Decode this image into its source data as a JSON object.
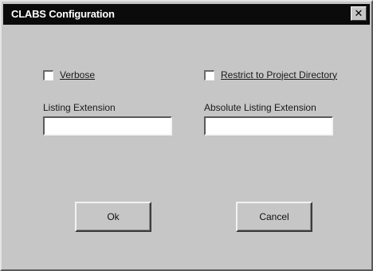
{
  "dialog": {
    "title": "CLABS Configuration",
    "close_glyph": "✕"
  },
  "options": {
    "verbose": {
      "label": "Verbose",
      "checked": false
    },
    "restrict": {
      "label": "Restrict to Project Directory",
      "checked": false
    }
  },
  "fields": {
    "listing_extension": {
      "label": "Listing Extension",
      "value": ""
    },
    "absolute_listing_extension": {
      "label": "Absolute Listing Extension",
      "value": ""
    }
  },
  "buttons": {
    "ok": "Ok",
    "cancel": "Cancel"
  }
}
